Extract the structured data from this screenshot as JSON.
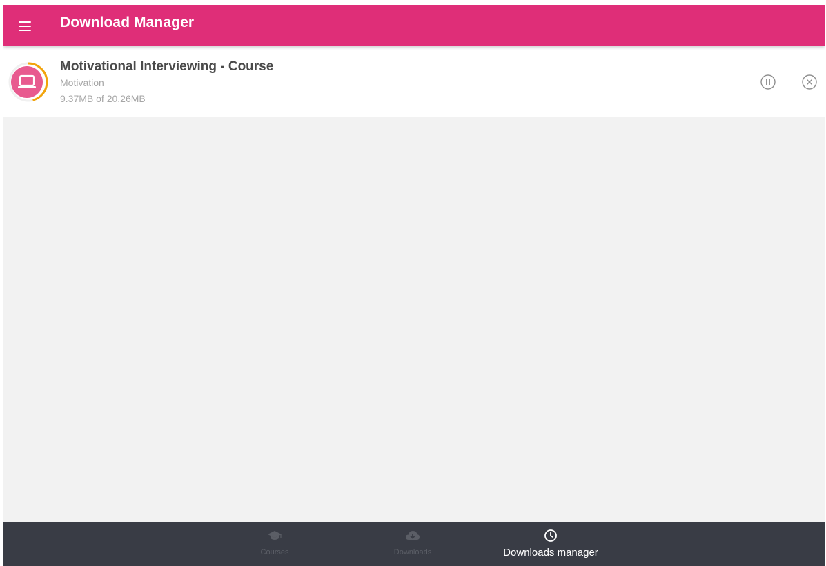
{
  "header": {
    "title": "Download Manager",
    "color": "#df2e78",
    "menu_icon": "hamburger-menu-icon"
  },
  "downloads": [
    {
      "title": "Motivational Interviewing - Course",
      "category": "Motivation",
      "size_text": "9.37MB of 20.26MB",
      "progress": 0.46,
      "icon": "laptop-icon",
      "actions": [
        "pause-icon",
        "cancel-icon"
      ]
    }
  ],
  "bottom_nav": {
    "tabs": [
      {
        "label": "Courses",
        "icon": "graduation-cap-icon",
        "active": false
      },
      {
        "label": "Downloads",
        "icon": "cloud-download-icon",
        "active": false
      },
      {
        "label": "Downloads manager",
        "icon": "clock-icon",
        "active": true
      }
    ]
  },
  "colors": {
    "accent": "#df2e78",
    "progress_ring": "#f2a40c",
    "nav_background": "#393c45",
    "inactive_tab": "#5b5e66"
  }
}
